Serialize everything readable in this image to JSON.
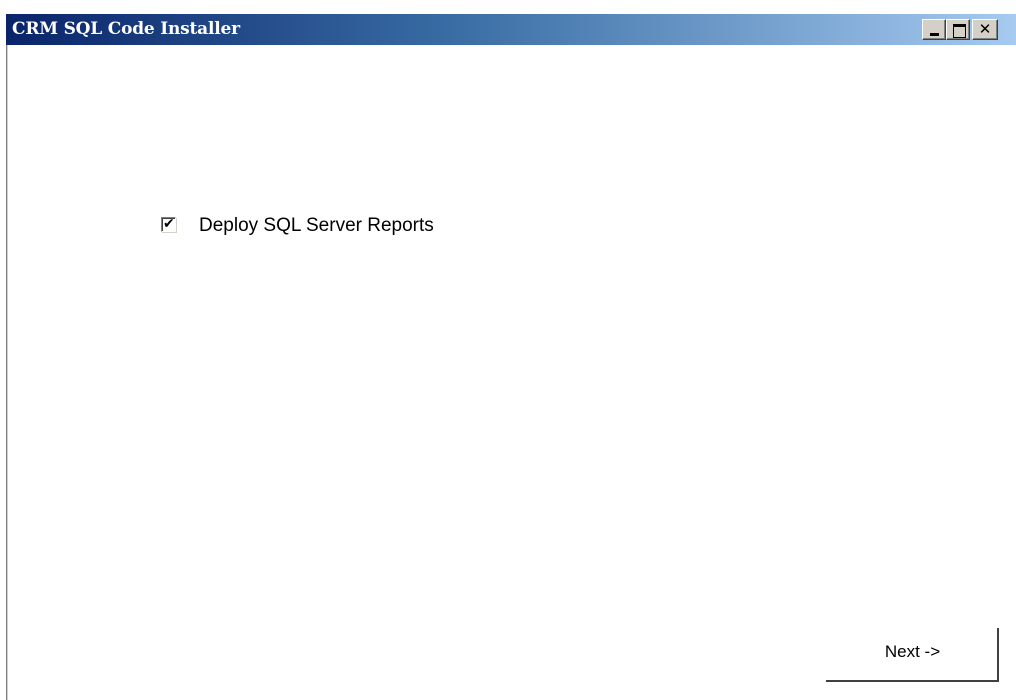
{
  "window": {
    "title": "CRM SQL Code Installer",
    "controls": {
      "minimize_icon": "minimize-icon",
      "maximize_icon": "maximize-icon",
      "close_glyph": "✕"
    }
  },
  "options": {
    "deploy_reports": {
      "label": "Deploy SQL Server Reports",
      "checked": true,
      "check_glyph": "✔"
    }
  },
  "footer": {
    "next_label": "Next ->"
  },
  "colors": {
    "titlebar_start": "#0a246a",
    "titlebar_end": "#a6caf0",
    "title_text": "#ffffff",
    "button_face": "#d4d0c8"
  }
}
